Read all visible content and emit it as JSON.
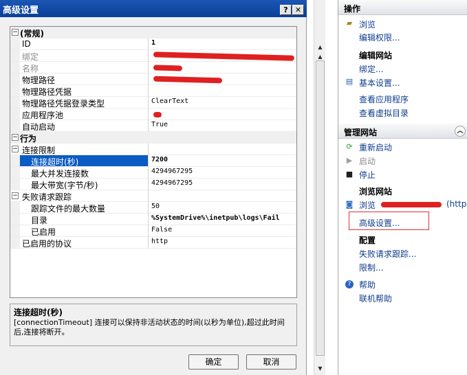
{
  "dialog": {
    "title": "高级设置",
    "help_glyph": "?",
    "close_glyph": "✕",
    "ok_label": "确定",
    "cancel_label": "取消"
  },
  "grid": {
    "rows": [
      {
        "label": "(常规)",
        "value": ""
      },
      {
        "label": "ID",
        "value": "1"
      },
      {
        "label": "绑定",
        "value": ""
      },
      {
        "label": "名称",
        "value": ""
      },
      {
        "label": "物理路径",
        "value": ""
      },
      {
        "label": "物理路径凭据",
        "value": ""
      },
      {
        "label": "物理路径凭据登录类型",
        "value": "ClearText"
      },
      {
        "label": "应用程序池",
        "value": ""
      },
      {
        "label": "自动启动",
        "value": "True"
      },
      {
        "label": "行为",
        "value": ""
      },
      {
        "label": "连接限制",
        "value": ""
      },
      {
        "label": "连接超时(秒)",
        "value": "7200"
      },
      {
        "label": "最大并发连接数",
        "value": "4294967295"
      },
      {
        "label": "最大带宽(字节/秒)",
        "value": "4294967295"
      },
      {
        "label": "失败请求跟踪",
        "value": ""
      },
      {
        "label": "跟踪文件的最大数量",
        "value": "50"
      },
      {
        "label": "目录",
        "value": "%SystemDrive%\\inetpub\\logs\\Fail"
      },
      {
        "label": "已启用",
        "value": "False"
      },
      {
        "label": "已启用的协议",
        "value": "http"
      }
    ]
  },
  "description": {
    "title": "连接超时(秒)",
    "text": "[connectionTimeout] 连接可以保持非活动状态的时间(以秒为单位),超过此时间后,连接将断开。"
  },
  "actions": {
    "header": "操作",
    "browse": "浏览",
    "edit_permissions": "编辑权限...",
    "edit_site_heading": "编辑网站",
    "bindings": "绑定...",
    "basic_settings": "基本设置...",
    "view_apps": "查看应用程序",
    "view_vdirs": "查看虚拟目录",
    "manage_header": "管理网站",
    "restart": "重新启动",
    "start": "启动",
    "stop": "停止",
    "browse_site_heading": "浏览网站",
    "browse_prefix": "浏览",
    "browse_suffix": "(http",
    "advanced_settings": "高级设置...",
    "config_heading": "配置",
    "failed_request_tracing": "失败请求跟踪...",
    "limits": "限制...",
    "help": "帮助",
    "online_help": "联机帮助"
  },
  "colors": {
    "title_bar": "#0a3f96",
    "selection": "#0a5bc4",
    "link": "#0f3d8a",
    "redaction": "#e02020",
    "highlight_box": "#e03030"
  }
}
